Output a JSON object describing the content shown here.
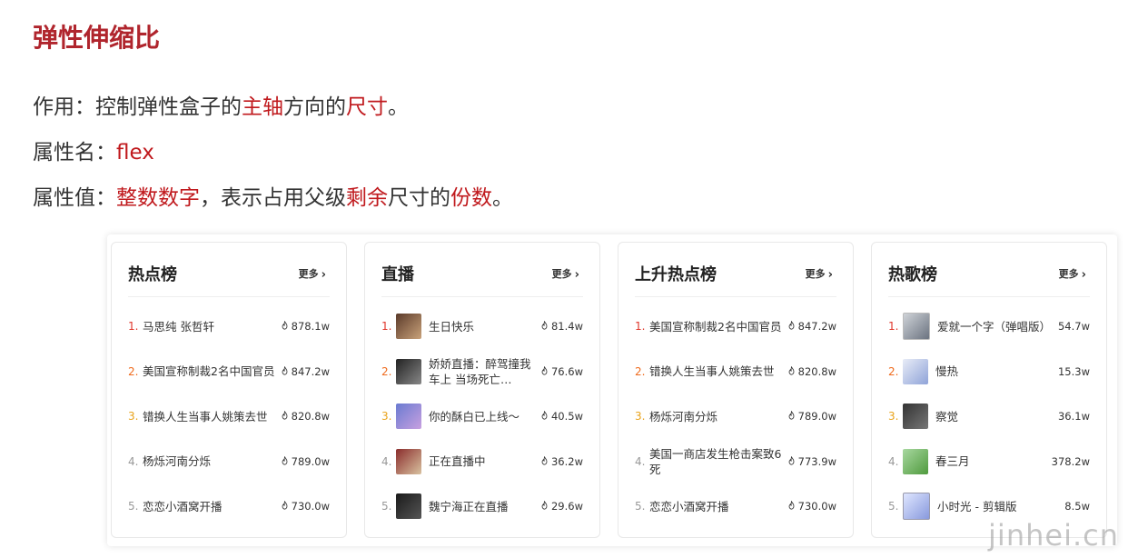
{
  "heading": "弹性伸缩比",
  "lines": {
    "l1": {
      "a": "作用：控制弹性盒子的",
      "b": "主轴",
      "c": "方向的",
      "d": "尺寸",
      "e": "。"
    },
    "l2": {
      "a": "属性名：",
      "b": "flex"
    },
    "l3": {
      "a": "属性值：",
      "b": "整数数字",
      "c": "，表示占用父级",
      "d": "剩余",
      "e": "尺寸的",
      "f": "份数",
      "g": "。"
    }
  },
  "more_label": "更多",
  "cards": [
    {
      "title": "热点榜",
      "rows": [
        {
          "rank": "1.",
          "name": "马思纯 张哲轩",
          "value": "878.1w"
        },
        {
          "rank": "2.",
          "name": "美国宣称制裁2名中国官员",
          "value": "847.2w"
        },
        {
          "rank": "3.",
          "name": "错换人生当事人姚策去世",
          "value": "820.8w"
        },
        {
          "rank": "4.",
          "name": "杨烁河南分烁",
          "value": "789.0w"
        },
        {
          "rank": "5.",
          "name": "恋恋小酒窝开播",
          "value": "730.0w"
        }
      ]
    },
    {
      "title": "直播",
      "rows": [
        {
          "rank": "1.",
          "name": "生日快乐",
          "value": "81.4w"
        },
        {
          "rank": "2.",
          "name": "娇娇直播：醉驾撞我车上 当场死亡…",
          "value": "76.6w"
        },
        {
          "rank": "3.",
          "name": "你的酥白已上线～",
          "value": "40.5w"
        },
        {
          "rank": "4.",
          "name": "正在直播中",
          "value": "36.2w"
        },
        {
          "rank": "5.",
          "name": "魏宁海正在直播",
          "value": "29.6w"
        }
      ]
    },
    {
      "title": "上升热点榜",
      "rows": [
        {
          "rank": "1.",
          "name": "美国宣称制裁2名中国官员",
          "value": "847.2w"
        },
        {
          "rank": "2.",
          "name": "错换人生当事人姚策去世",
          "value": "820.8w"
        },
        {
          "rank": "3.",
          "name": "杨烁河南分烁",
          "value": "789.0w"
        },
        {
          "rank": "4.",
          "name": "美国一商店发生枪击案致6死",
          "value": "773.9w"
        },
        {
          "rank": "5.",
          "name": "恋恋小酒窝开播",
          "value": "730.0w"
        }
      ]
    },
    {
      "title": "热歌榜",
      "rows": [
        {
          "rank": "1.",
          "name": "爱就一个字（弹唱版）",
          "value": "54.7w"
        },
        {
          "rank": "2.",
          "name": "慢热",
          "value": "15.3w"
        },
        {
          "rank": "3.",
          "name": "察觉",
          "value": "36.1w"
        },
        {
          "rank": "4.",
          "name": "春三月",
          "value": "378.2w"
        },
        {
          "rank": "5.",
          "name": "小时光 - 剪辑版",
          "value": "8.5w"
        }
      ]
    }
  ],
  "watermark": "jinhei.cn",
  "colors": {
    "heading": "#b0252d",
    "highlight": "#c0191d",
    "rank1": "#e0372c",
    "rank2": "#ef6b1e",
    "rank3": "#e9a31b"
  }
}
